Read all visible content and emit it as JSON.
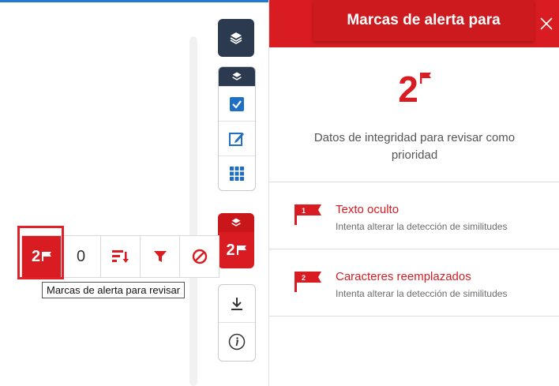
{
  "toolbar": {
    "flags_count": "2",
    "zero_count": "0",
    "tooltip": "Marcas de alerta para revisar"
  },
  "rail": {
    "flags_count": "2"
  },
  "panel": {
    "title": "Marcas de alerta para",
    "big_count": "2",
    "summary": "Datos de integridad para revisar como prioridad",
    "items": [
      {
        "badge": "1",
        "title": "Texto oculto",
        "subtitle": "Intenta alterar la detección de similitudes"
      },
      {
        "badge": "2",
        "title": "Caracteres reemplazados",
        "subtitle": "Intenta alterar la detección de similitudes"
      }
    ]
  },
  "colors": {
    "accent_red": "#d81c21",
    "rail_dark": "#2b3a4e",
    "icon_blue": "#1f6fc4"
  }
}
